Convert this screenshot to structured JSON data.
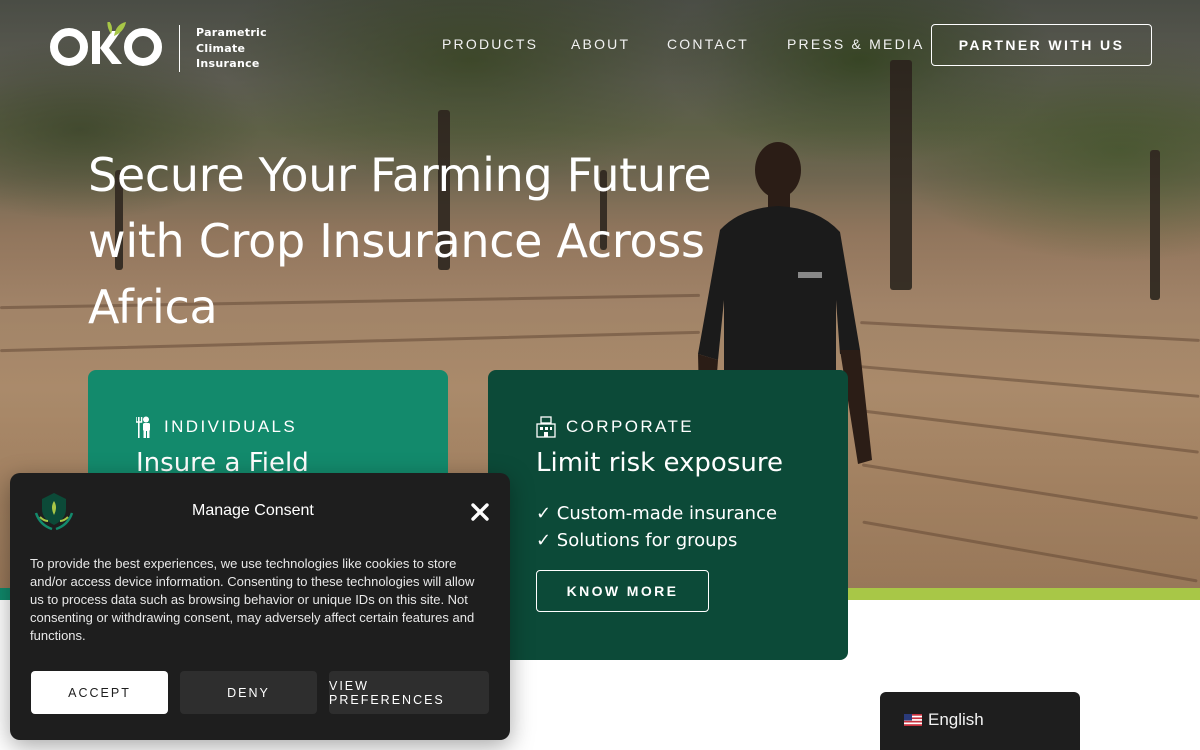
{
  "brand": {
    "logo_text": "OKO",
    "tagline": [
      "Parametric",
      "Climate",
      "Insurance"
    ]
  },
  "nav": {
    "items": [
      "PRODUCTS",
      "ABOUT",
      "CONTACT",
      "PRESS & MEDIA"
    ],
    "cta": "PARTNER WITH US"
  },
  "hero": {
    "headline_lines": [
      "Secure Your Farming Future",
      "with Crop Insurance Across",
      "Africa"
    ]
  },
  "cards": {
    "individuals": {
      "label": "INDIVIDUALS",
      "title": "Insure a Field",
      "icon": "farmer-icon"
    },
    "corporate": {
      "label": "CORPORATE",
      "title": "Limit risk exposure",
      "bullets": [
        "✓ Custom-made insurance",
        "✓ Solutions for groups"
      ],
      "button": "KNOW MORE",
      "icon": "building-icon"
    }
  },
  "consent": {
    "title": "Manage Consent",
    "text": "To provide the best experiences, we use technologies like cookies to store and/or access device information. Consenting to these technologies will allow us to process data such as browsing behavior or unique IDs on this site. Not consenting or withdrawing consent, may adversely affect certain features and functions.",
    "accept": "ACCEPT",
    "deny": "DENY",
    "preferences": "VIEW PREFERENCES"
  },
  "language": {
    "current": "English",
    "flag": "us-flag-icon"
  },
  "colors": {
    "individuals_card": "#138a6c",
    "corporate_card": "#0c4a38",
    "accent_bar": "#a8c747",
    "modal_bg": "#1e1e1e"
  }
}
